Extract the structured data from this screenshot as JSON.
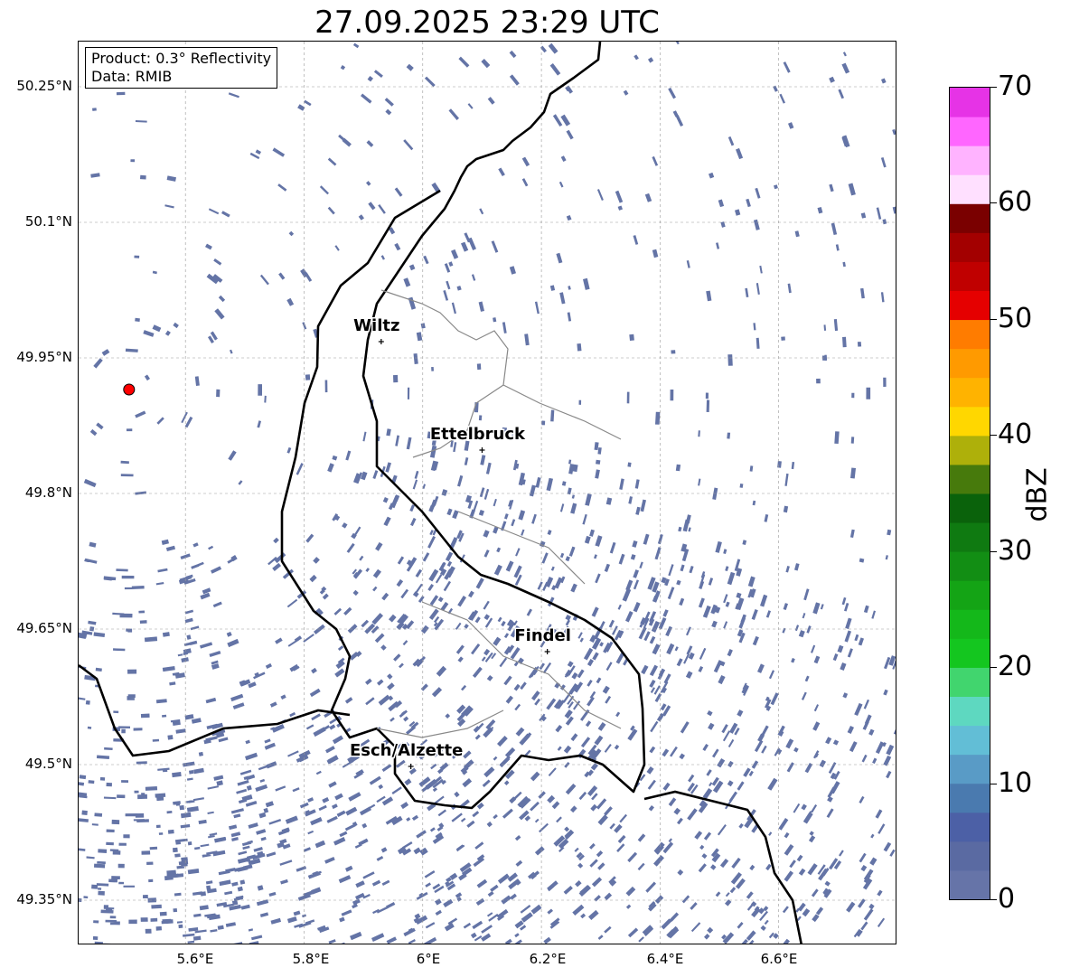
{
  "title": "27.09.2025 23:29 UTC",
  "info": {
    "product": "Product: 0.3° Reflectivity",
    "data": "Data: RMIB"
  },
  "axes": {
    "lat_labels": [
      "50.25°N",
      "50.1°N",
      "49.95°N",
      "49.8°N",
      "49.65°N",
      "49.5°N",
      "49.35°N"
    ],
    "lon_labels": [
      "5.6°E",
      "5.8°E",
      "6°E",
      "6.2°E",
      "6.4°E",
      "6.6°E"
    ],
    "lon_range": [
      5.42,
      6.8
    ],
    "lat_range": [
      49.3,
      50.3
    ]
  },
  "cities": [
    {
      "name": "Wiltz",
      "lon": 5.93,
      "lat": 49.968
    },
    {
      "name": "Ettelbruck",
      "lon": 6.1,
      "lat": 49.848
    },
    {
      "name": "Findel",
      "lon": 6.21,
      "lat": 49.625
    },
    {
      "name": "Esch/Alzette",
      "lon": 5.98,
      "lat": 49.498
    }
  ],
  "radar_site": {
    "lon": 5.505,
    "lat": 49.915,
    "color": "#ff0000"
  },
  "colorbar": {
    "label": "dBZ",
    "ticks": [
      "0",
      "10",
      "20",
      "30",
      "40",
      "50",
      "60",
      "70"
    ],
    "colors": [
      "#6674a8",
      "#5a6aa2",
      "#4c60a6",
      "#4a7aaf",
      "#599bc6",
      "#62bed6",
      "#5ed8c0",
      "#41d56e",
      "#14c61f",
      "#14b81a",
      "#14a415",
      "#128e14",
      "#0f7a11",
      "#0a620b",
      "#477a0c",
      "#aeb00a",
      "#ffd700",
      "#ffb300",
      "#ff9a00",
      "#ff7c00",
      "#e50000",
      "#c00000",
      "#a30000",
      "#7a0000",
      "#ffe0ff",
      "#ffb3ff",
      "#ff66ff",
      "#e633e6"
    ]
  },
  "echo_color": "#6474a6"
}
